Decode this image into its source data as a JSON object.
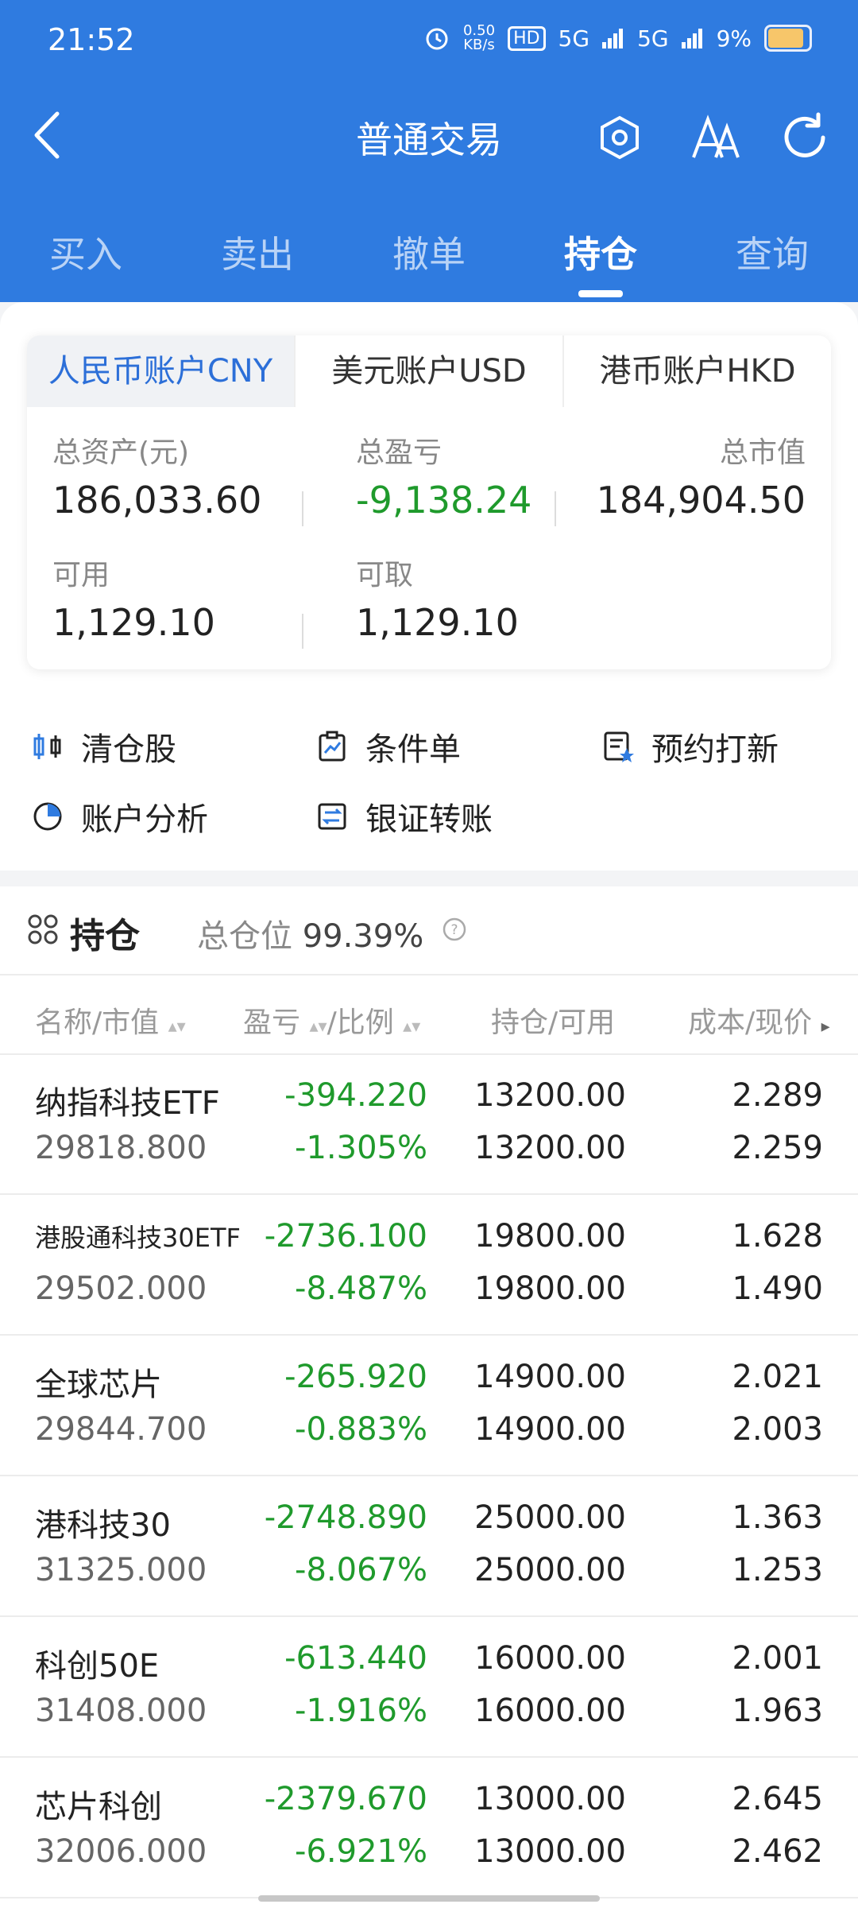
{
  "status": {
    "time": "21:52",
    "speed_top": "0.50",
    "speed_unit": "KB/s",
    "hd": "HD",
    "net1": "5G",
    "net2": "5G",
    "battery": "9%"
  },
  "header": {
    "title": "普通交易"
  },
  "tabs": [
    "买入",
    "卖出",
    "撤单",
    "持仓",
    "查询"
  ],
  "accounts": {
    "tabs": [
      "人民币账户CNY",
      "美元账户USD",
      "港币账户HKD"
    ]
  },
  "summary": {
    "total_assets_label": "总资产(元)",
    "total_assets": "186,033.60",
    "total_pl_label": "总盈亏",
    "total_pl": "-9,138.24",
    "market_value_label": "总市值",
    "market_value": "184,904.50",
    "available_label": "可用",
    "available": "1,129.10",
    "withdrawable_label": "可取",
    "withdrawable": "1,129.10"
  },
  "actions": [
    "清仓股",
    "条件单",
    "预约打新",
    "账户分析",
    "银证转账"
  ],
  "holdings": {
    "title": "持仓",
    "position_label": "总仓位",
    "position_value": "99.39%",
    "columns": [
      "名称/市值",
      "盈亏",
      "/比例",
      "持仓/可用",
      "成本/现价"
    ],
    "rows": [
      {
        "name": "纳指科技ETF",
        "mv": "29818.800",
        "pl": "-394.220",
        "pct": "-1.305%",
        "hold": "13200.00",
        "avail": "13200.00",
        "cost": "2.289",
        "price": "2.259"
      },
      {
        "name": "港股通科技30ETF",
        "mv": "29502.000",
        "pl": "-2736.100",
        "pct": "-8.487%",
        "hold": "19800.00",
        "avail": "19800.00",
        "cost": "1.628",
        "price": "1.490"
      },
      {
        "name": "全球芯片",
        "mv": "29844.700",
        "pl": "-265.920",
        "pct": "-0.883%",
        "hold": "14900.00",
        "avail": "14900.00",
        "cost": "2.021",
        "price": "2.003"
      },
      {
        "name": "港科技30",
        "mv": "31325.000",
        "pl": "-2748.890",
        "pct": "-8.067%",
        "hold": "25000.00",
        "avail": "25000.00",
        "cost": "1.363",
        "price": "1.253"
      },
      {
        "name": "科创50E",
        "mv": "31408.000",
        "pl": "-613.440",
        "pct": "-1.916%",
        "hold": "16000.00",
        "avail": "16000.00",
        "cost": "2.001",
        "price": "1.963"
      },
      {
        "name": "芯片科创",
        "mv": "32006.000",
        "pl": "-2379.670",
        "pct": "-6.921%",
        "hold": "13000.00",
        "avail": "13000.00",
        "cost": "2.645",
        "price": "2.462"
      }
    ]
  }
}
